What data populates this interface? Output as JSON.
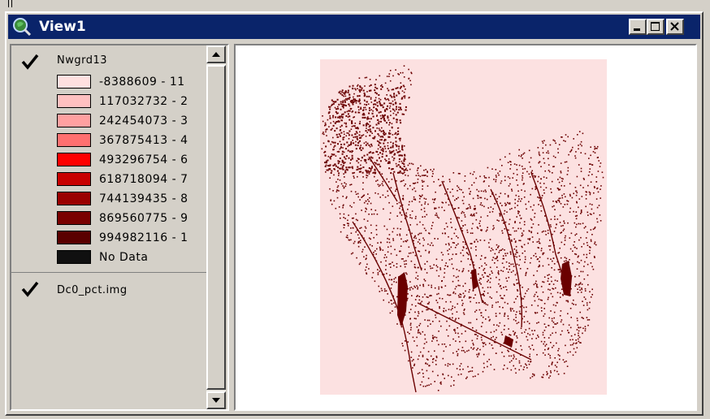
{
  "window": {
    "title": "View1",
    "app_icon": "magnifier-globe-icon",
    "controls": [
      "minimize-icon",
      "maximize-icon",
      "close-icon"
    ]
  },
  "toc": {
    "layers": [
      {
        "name": "Nwgrd13",
        "visible": true,
        "legend": [
          {
            "label": "-8388609 - 11",
            "color": "#ffe0e0"
          },
          {
            "label": "117032732 - 2",
            "color": "#ffc0c0"
          },
          {
            "label": "242454073 - 3",
            "color": "#ffa0a0"
          },
          {
            "label": "367875413 - 4",
            "color": "#ff7070"
          },
          {
            "label": "493296754 - 6",
            "color": "#ff0000"
          },
          {
            "label": "618718094 - 7",
            "color": "#c80000"
          },
          {
            "label": "744139435 - 8",
            "color": "#9a0000"
          },
          {
            "label": "869560775 - 9",
            "color": "#7a0000"
          },
          {
            "label": "994982116 - 1",
            "color": "#5a0000"
          },
          {
            "label": "No Data",
            "color": "#101010"
          }
        ]
      },
      {
        "name": "Dc0_pct.img",
        "visible": true
      }
    ]
  },
  "map": {
    "background_color": "#fce1e1",
    "feature_color": "#6b0000"
  }
}
